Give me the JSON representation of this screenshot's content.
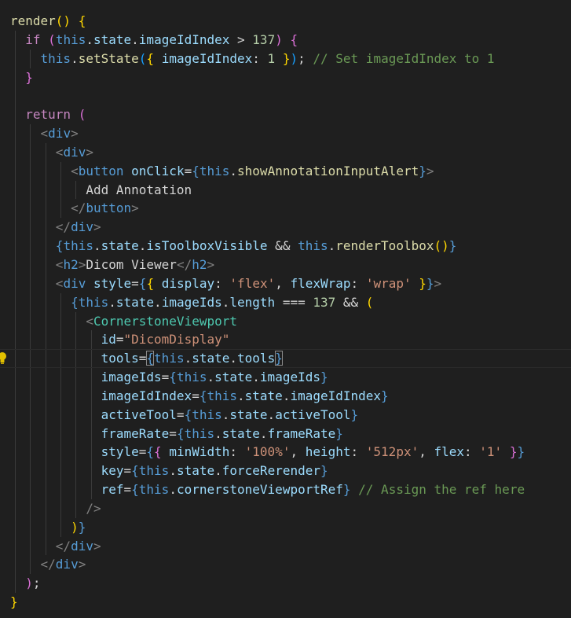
{
  "colors": {
    "background": "#1f1f1f",
    "text": "#d4d4d4",
    "keyword": "#c586c0",
    "this": "#569cd6",
    "function": "#dcdcaa",
    "property": "#9cdcfe",
    "string": "#ce9178",
    "number": "#b5cea8",
    "comment": "#6a9955",
    "tag": "#569cd6",
    "component": "#4ec9b0",
    "bracket1": "#ffd700",
    "bracket2": "#da70d6",
    "bracket3": "#179fff",
    "tagbracket": "#808080"
  },
  "editor": {
    "lines": [
      {
        "indent": 0,
        "tokens": [
          {
            "t": "render",
            "c": "function"
          },
          {
            "t": "()",
            "c": "bracket1"
          },
          {
            "t": " ",
            "c": "text"
          },
          {
            "t": "{",
            "c": "bracket1"
          }
        ]
      },
      {
        "indent": 1,
        "tokens": [
          {
            "t": "if",
            "c": "keyword"
          },
          {
            "t": " ",
            "c": "text"
          },
          {
            "t": "(",
            "c": "bracket2"
          },
          {
            "t": "this",
            "c": "this"
          },
          {
            "t": ".",
            "c": "text"
          },
          {
            "t": "state",
            "c": "property"
          },
          {
            "t": ".",
            "c": "text"
          },
          {
            "t": "imageIdIndex",
            "c": "property"
          },
          {
            "t": " > ",
            "c": "text"
          },
          {
            "t": "137",
            "c": "number"
          },
          {
            "t": ")",
            "c": "bracket2"
          },
          {
            "t": " ",
            "c": "text"
          },
          {
            "t": "{",
            "c": "bracket2"
          }
        ]
      },
      {
        "indent": 2,
        "tokens": [
          {
            "t": "this",
            "c": "this"
          },
          {
            "t": ".",
            "c": "text"
          },
          {
            "t": "setState",
            "c": "function"
          },
          {
            "t": "(",
            "c": "bracket3"
          },
          {
            "t": "{",
            "c": "bracket1"
          },
          {
            "t": " ",
            "c": "text"
          },
          {
            "t": "imageIdIndex",
            "c": "property"
          },
          {
            "t": ": ",
            "c": "text"
          },
          {
            "t": "1",
            "c": "number"
          },
          {
            "t": " ",
            "c": "text"
          },
          {
            "t": "}",
            "c": "bracket1"
          },
          {
            "t": ")",
            "c": "bracket3"
          },
          {
            "t": "; ",
            "c": "text"
          },
          {
            "t": "// Set imageIdIndex to 1",
            "c": "comment"
          }
        ]
      },
      {
        "indent": 1,
        "tokens": [
          {
            "t": "}",
            "c": "bracket2"
          }
        ]
      },
      {
        "indent": 1,
        "tokens": []
      },
      {
        "indent": 1,
        "tokens": [
          {
            "t": "return",
            "c": "keyword"
          },
          {
            "t": " ",
            "c": "text"
          },
          {
            "t": "(",
            "c": "bracket2"
          }
        ]
      },
      {
        "indent": 2,
        "tokens": [
          {
            "t": "<",
            "c": "tagbracket"
          },
          {
            "t": "div",
            "c": "tag"
          },
          {
            "t": ">",
            "c": "tagbracket"
          }
        ]
      },
      {
        "indent": 3,
        "tokens": [
          {
            "t": "<",
            "c": "tagbracket"
          },
          {
            "t": "div",
            "c": "tag"
          },
          {
            "t": ">",
            "c": "tagbracket"
          }
        ]
      },
      {
        "indent": 4,
        "tokens": [
          {
            "t": "<",
            "c": "tagbracket"
          },
          {
            "t": "button",
            "c": "tag"
          },
          {
            "t": " ",
            "c": "text"
          },
          {
            "t": "onClick",
            "c": "property"
          },
          {
            "t": "=",
            "c": "text"
          },
          {
            "t": "{",
            "c": "this"
          },
          {
            "t": "this",
            "c": "this"
          },
          {
            "t": ".",
            "c": "text"
          },
          {
            "t": "showAnnotationInputAlert",
            "c": "function"
          },
          {
            "t": "}",
            "c": "this"
          },
          {
            "t": ">",
            "c": "tagbracket"
          }
        ]
      },
      {
        "indent": 5,
        "tokens": [
          {
            "t": "Add Annotation",
            "c": "text"
          }
        ]
      },
      {
        "indent": 4,
        "tokens": [
          {
            "t": "</",
            "c": "tagbracket"
          },
          {
            "t": "button",
            "c": "tag"
          },
          {
            "t": ">",
            "c": "tagbracket"
          }
        ]
      },
      {
        "indent": 3,
        "tokens": [
          {
            "t": "</",
            "c": "tagbracket"
          },
          {
            "t": "div",
            "c": "tag"
          },
          {
            "t": ">",
            "c": "tagbracket"
          }
        ]
      },
      {
        "indent": 3,
        "tokens": [
          {
            "t": "{",
            "c": "this"
          },
          {
            "t": "this",
            "c": "this"
          },
          {
            "t": ".",
            "c": "text"
          },
          {
            "t": "state",
            "c": "property"
          },
          {
            "t": ".",
            "c": "text"
          },
          {
            "t": "isToolboxVisible",
            "c": "property"
          },
          {
            "t": " && ",
            "c": "text"
          },
          {
            "t": "this",
            "c": "this"
          },
          {
            "t": ".",
            "c": "text"
          },
          {
            "t": "renderToolbox",
            "c": "function"
          },
          {
            "t": "()",
            "c": "bracket1"
          },
          {
            "t": "}",
            "c": "this"
          }
        ]
      },
      {
        "indent": 3,
        "tokens": [
          {
            "t": "<",
            "c": "tagbracket"
          },
          {
            "t": "h2",
            "c": "tag"
          },
          {
            "t": ">",
            "c": "tagbracket"
          },
          {
            "t": "Dicom Viewer",
            "c": "text"
          },
          {
            "t": "</",
            "c": "tagbracket"
          },
          {
            "t": "h2",
            "c": "tag"
          },
          {
            "t": ">",
            "c": "tagbracket"
          }
        ]
      },
      {
        "indent": 3,
        "tokens": [
          {
            "t": "<",
            "c": "tagbracket"
          },
          {
            "t": "div",
            "c": "tag"
          },
          {
            "t": " ",
            "c": "text"
          },
          {
            "t": "style",
            "c": "property"
          },
          {
            "t": "=",
            "c": "text"
          },
          {
            "t": "{",
            "c": "this"
          },
          {
            "t": "{",
            "c": "bracket1"
          },
          {
            "t": " ",
            "c": "text"
          },
          {
            "t": "display",
            "c": "property"
          },
          {
            "t": ": ",
            "c": "text"
          },
          {
            "t": "'flex'",
            "c": "string"
          },
          {
            "t": ", ",
            "c": "text"
          },
          {
            "t": "flexWrap",
            "c": "property"
          },
          {
            "t": ": ",
            "c": "text"
          },
          {
            "t": "'wrap'",
            "c": "string"
          },
          {
            "t": " ",
            "c": "text"
          },
          {
            "t": "}",
            "c": "bracket1"
          },
          {
            "t": "}",
            "c": "this"
          },
          {
            "t": ">",
            "c": "tagbracket"
          }
        ]
      },
      {
        "indent": 4,
        "tokens": [
          {
            "t": "{",
            "c": "this"
          },
          {
            "t": "this",
            "c": "this"
          },
          {
            "t": ".",
            "c": "text"
          },
          {
            "t": "state",
            "c": "property"
          },
          {
            "t": ".",
            "c": "text"
          },
          {
            "t": "imageIds",
            "c": "property"
          },
          {
            "t": ".",
            "c": "text"
          },
          {
            "t": "length",
            "c": "property"
          },
          {
            "t": " === ",
            "c": "text"
          },
          {
            "t": "137",
            "c": "number"
          },
          {
            "t": " && ",
            "c": "text"
          },
          {
            "t": "(",
            "c": "bracket1"
          }
        ]
      },
      {
        "indent": 5,
        "tokens": [
          {
            "t": "<",
            "c": "tagbracket"
          },
          {
            "t": "CornerstoneViewport",
            "c": "component"
          }
        ]
      },
      {
        "indent": 6,
        "tokens": [
          {
            "t": "id",
            "c": "property"
          },
          {
            "t": "=",
            "c": "text"
          },
          {
            "t": "\"DicomDisplay\"",
            "c": "string"
          }
        ]
      },
      {
        "indent": 6,
        "current": true,
        "bulb": true,
        "tokens": [
          {
            "t": "tools",
            "c": "property"
          },
          {
            "t": "=",
            "c": "text"
          },
          {
            "t": "{",
            "c": "this",
            "box": true
          },
          {
            "t": "this",
            "c": "this"
          },
          {
            "t": ".",
            "c": "text"
          },
          {
            "t": "state",
            "c": "property"
          },
          {
            "t": ".",
            "c": "text"
          },
          {
            "t": "tools",
            "c": "property"
          },
          {
            "t": "}",
            "c": "this",
            "box": true
          }
        ]
      },
      {
        "indent": 6,
        "tokens": [
          {
            "t": "imageIds",
            "c": "property"
          },
          {
            "t": "=",
            "c": "text"
          },
          {
            "t": "{",
            "c": "this"
          },
          {
            "t": "this",
            "c": "this"
          },
          {
            "t": ".",
            "c": "text"
          },
          {
            "t": "state",
            "c": "property"
          },
          {
            "t": ".",
            "c": "text"
          },
          {
            "t": "imageIds",
            "c": "property"
          },
          {
            "t": "}",
            "c": "this"
          }
        ]
      },
      {
        "indent": 6,
        "tokens": [
          {
            "t": "imageIdIndex",
            "c": "property"
          },
          {
            "t": "=",
            "c": "text"
          },
          {
            "t": "{",
            "c": "this"
          },
          {
            "t": "this",
            "c": "this"
          },
          {
            "t": ".",
            "c": "text"
          },
          {
            "t": "state",
            "c": "property"
          },
          {
            "t": ".",
            "c": "text"
          },
          {
            "t": "imageIdIndex",
            "c": "property"
          },
          {
            "t": "}",
            "c": "this"
          }
        ]
      },
      {
        "indent": 6,
        "tokens": [
          {
            "t": "activeTool",
            "c": "property"
          },
          {
            "t": "=",
            "c": "text"
          },
          {
            "t": "{",
            "c": "this"
          },
          {
            "t": "this",
            "c": "this"
          },
          {
            "t": ".",
            "c": "text"
          },
          {
            "t": "state",
            "c": "property"
          },
          {
            "t": ".",
            "c": "text"
          },
          {
            "t": "activeTool",
            "c": "property"
          },
          {
            "t": "}",
            "c": "this"
          }
        ]
      },
      {
        "indent": 6,
        "tokens": [
          {
            "t": "frameRate",
            "c": "property"
          },
          {
            "t": "=",
            "c": "text"
          },
          {
            "t": "{",
            "c": "this"
          },
          {
            "t": "this",
            "c": "this"
          },
          {
            "t": ".",
            "c": "text"
          },
          {
            "t": "state",
            "c": "property"
          },
          {
            "t": ".",
            "c": "text"
          },
          {
            "t": "frameRate",
            "c": "property"
          },
          {
            "t": "}",
            "c": "this"
          }
        ]
      },
      {
        "indent": 6,
        "tokens": [
          {
            "t": "style",
            "c": "property"
          },
          {
            "t": "=",
            "c": "text"
          },
          {
            "t": "{",
            "c": "this"
          },
          {
            "t": "{",
            "c": "bracket2"
          },
          {
            "t": " ",
            "c": "text"
          },
          {
            "t": "minWidth",
            "c": "property"
          },
          {
            "t": ": ",
            "c": "text"
          },
          {
            "t": "'100%'",
            "c": "string"
          },
          {
            "t": ", ",
            "c": "text"
          },
          {
            "t": "height",
            "c": "property"
          },
          {
            "t": ": ",
            "c": "text"
          },
          {
            "t": "'512px'",
            "c": "string"
          },
          {
            "t": ", ",
            "c": "text"
          },
          {
            "t": "flex",
            "c": "property"
          },
          {
            "t": ": ",
            "c": "text"
          },
          {
            "t": "'1'",
            "c": "string"
          },
          {
            "t": " ",
            "c": "text"
          },
          {
            "t": "}",
            "c": "bracket2"
          },
          {
            "t": "}",
            "c": "this"
          }
        ]
      },
      {
        "indent": 6,
        "tokens": [
          {
            "t": "key",
            "c": "property"
          },
          {
            "t": "=",
            "c": "text"
          },
          {
            "t": "{",
            "c": "this"
          },
          {
            "t": "this",
            "c": "this"
          },
          {
            "t": ".",
            "c": "text"
          },
          {
            "t": "state",
            "c": "property"
          },
          {
            "t": ".",
            "c": "text"
          },
          {
            "t": "forceRerender",
            "c": "property"
          },
          {
            "t": "}",
            "c": "this"
          }
        ]
      },
      {
        "indent": 6,
        "tokens": [
          {
            "t": "ref",
            "c": "property"
          },
          {
            "t": "=",
            "c": "text"
          },
          {
            "t": "{",
            "c": "this"
          },
          {
            "t": "this",
            "c": "this"
          },
          {
            "t": ".",
            "c": "text"
          },
          {
            "t": "cornerstoneViewportRef",
            "c": "property"
          },
          {
            "t": "}",
            "c": "this"
          },
          {
            "t": " ",
            "c": "text"
          },
          {
            "t": "// Assign the ref here",
            "c": "comment"
          }
        ]
      },
      {
        "indent": 5,
        "tokens": [
          {
            "t": "/>",
            "c": "tagbracket"
          }
        ]
      },
      {
        "indent": 4,
        "tokens": [
          {
            "t": ")",
            "c": "bracket1"
          },
          {
            "t": "}",
            "c": "this"
          }
        ]
      },
      {
        "indent": 3,
        "tokens": [
          {
            "t": "</",
            "c": "tagbracket"
          },
          {
            "t": "div",
            "c": "tag"
          },
          {
            "t": ">",
            "c": "tagbracket"
          }
        ]
      },
      {
        "indent": 2,
        "tokens": [
          {
            "t": "</",
            "c": "tagbracket"
          },
          {
            "t": "div",
            "c": "tag"
          },
          {
            "t": ">",
            "c": "tagbracket"
          }
        ]
      },
      {
        "indent": 1,
        "tokens": [
          {
            "t": ")",
            "c": "bracket2"
          },
          {
            "t": ";",
            "c": "text"
          }
        ]
      },
      {
        "indent": 0,
        "tokens": [
          {
            "t": "}",
            "c": "bracket1"
          }
        ]
      }
    ]
  }
}
